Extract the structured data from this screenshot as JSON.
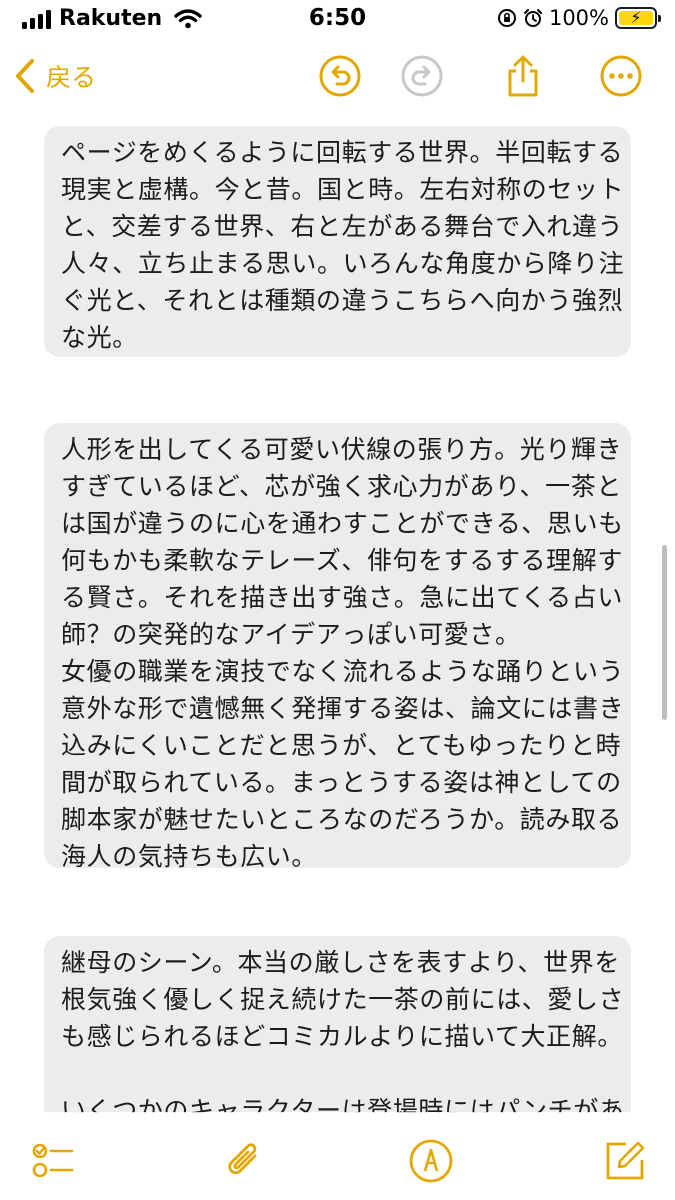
{
  "status_bar": {
    "carrier": "Rakuten",
    "time": "6:50",
    "battery_percent": "100%",
    "battery_level": 1.0,
    "icons": [
      "signal-icon",
      "wifi-icon",
      "orientation-lock-icon",
      "alarm-icon",
      "battery-charging-icon"
    ]
  },
  "nav": {
    "back_label": "戻る",
    "icons": [
      "chevron-left-icon",
      "undo-icon",
      "redo-icon",
      "share-icon",
      "more-icon"
    ]
  },
  "colors": {
    "accent": "#e3a800",
    "disabled": "#c7c7cc",
    "block_background": "#ececee",
    "text": "#1c1c1e"
  },
  "note": {
    "blocks": [
      {
        "lines": [
          "ページをめくるように回転する世界。半回転する",
          "現実と虚構。今と昔。国と時。左右対称のセット",
          "と、交差する世界、右と左がある舞台で入れ違う",
          "人々、立ち止まる思い。いろんな角度から降り注",
          "ぐ光と、それとは種類の違うこちらへ向かう強烈",
          "な光。"
        ]
      },
      {
        "lines": [
          "人形を出してくる可愛い伏線の張り方。光り輝き",
          "すぎているほど、芯が強く求心力があり、一茶と",
          "は国が違うのに心を通わすことができる、思いも",
          "何もかも柔軟なテレーズ、俳句をするする理解す",
          "る賢さ。それを描き出す強さ。急に出てくる占い",
          "師？の突発的なアイデアっぽい可愛さ。",
          "女優の職業を演技でなく流れるような踊りという",
          "意外な形で遺憾無く発揮する姿は、論文には書き",
          "込みにくいことだと思うが、とてもゆったりと時",
          "間が取られている。まっとうする姿は神としての",
          "脚本家が魅せたいところなのだろうか。読み取る",
          "海人の気持ちも広い。"
        ]
      },
      {
        "lines": [
          "継母のシーン。本当の厳しさを表すより、世界を",
          "根気強く優しく捉え続けた一茶の前には、愛しさ",
          "も感じられるほどコミカルよりに描いて大正解。",
          "",
          "いくつかのキャラクターは登場時にはパンチがあ"
        ]
      }
    ]
  },
  "toolbar": {
    "icons": [
      "checklist-icon",
      "paperclip-icon",
      "markup-pen-icon",
      "compose-icon"
    ]
  }
}
